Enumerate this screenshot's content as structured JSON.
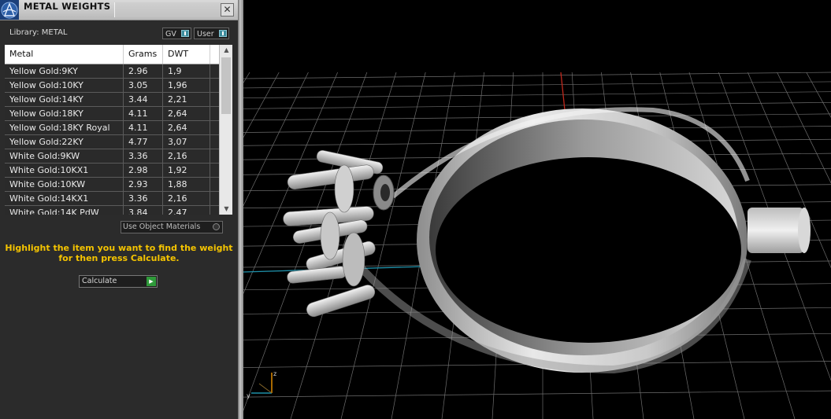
{
  "panel": {
    "title": "METAL WEIGHTS",
    "close_symbol": "✕",
    "library_label": "Library: METAL",
    "toggle_gv": "GV",
    "toggle_user": "User",
    "table": {
      "headers": [
        "Metal",
        "Grams",
        "DWT"
      ],
      "rows": [
        [
          "Yellow Gold:9KY",
          "2.96",
          "1,9"
        ],
        [
          "Yellow Gold:10KY",
          "3.05",
          "1,96"
        ],
        [
          "Yellow Gold:14KY",
          "3.44",
          "2,21"
        ],
        [
          "Yellow Gold:18KY",
          "4.11",
          "2,64"
        ],
        [
          "Yellow Gold:18KY Royal",
          "4.11",
          "2,64"
        ],
        [
          "Yellow Gold:22KY",
          "4.77",
          "3,07"
        ],
        [
          "White Gold:9KW",
          "3.36",
          "2,16"
        ],
        [
          "White Gold:10KX1",
          "2.98",
          "1,92"
        ],
        [
          "White Gold:10KW",
          "2.93",
          "1,88"
        ],
        [
          "White Gold:14KX1",
          "3.36",
          "2,16"
        ],
        [
          "White Gold:14K PdW",
          "3.84",
          "2,47"
        ]
      ]
    },
    "use_object_materials": "Use Object Materials",
    "hint_line1": "Highlight the item you want to find the weight",
    "hint_line2": "for then press Calculate.",
    "calculate_label": "Calculate"
  },
  "viewport": {
    "axis_label_z": "z",
    "axis_label_y": "y",
    "colors": {
      "grid": "#6e6e6e",
      "axis_red": "#c0281c",
      "axis_cyan": "#1e8fa8",
      "hint": "#f5c400"
    }
  }
}
